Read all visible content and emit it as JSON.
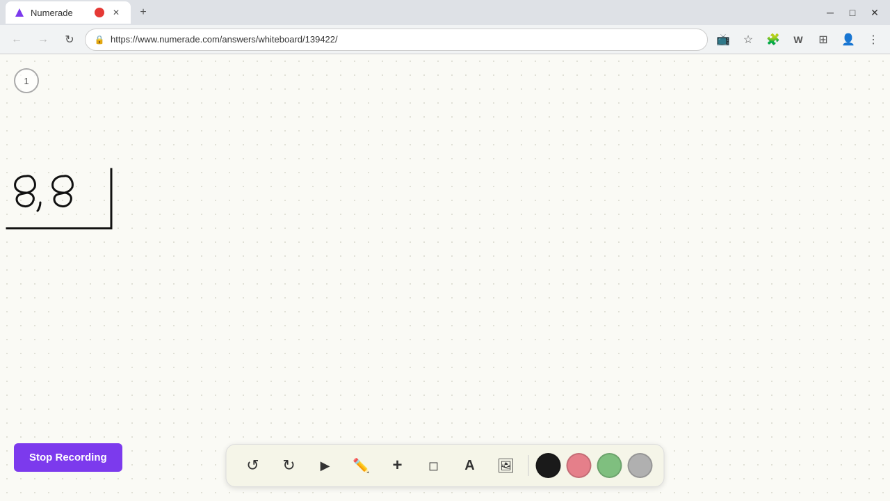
{
  "browser": {
    "tab": {
      "title": "Numerade",
      "favicon": "N",
      "url": "https://www.numerade.com/answers/whiteboard/139422/"
    },
    "window_controls": {
      "minimize": "─",
      "maximize": "□",
      "close": "✕"
    }
  },
  "timer": {
    "label": "1"
  },
  "stop_recording": {
    "label": "Stop Recording"
  },
  "toolbar": {
    "undo": "↺",
    "redo": "↻",
    "select": "▶",
    "pen": "✏",
    "add": "+",
    "eraser": "◻",
    "text": "A",
    "image": "🖼",
    "color_black": "#1a1a1a",
    "color_pink": "#e57f8a",
    "color_green": "#7fbf7f",
    "color_gray": "#b0b0b0"
  }
}
